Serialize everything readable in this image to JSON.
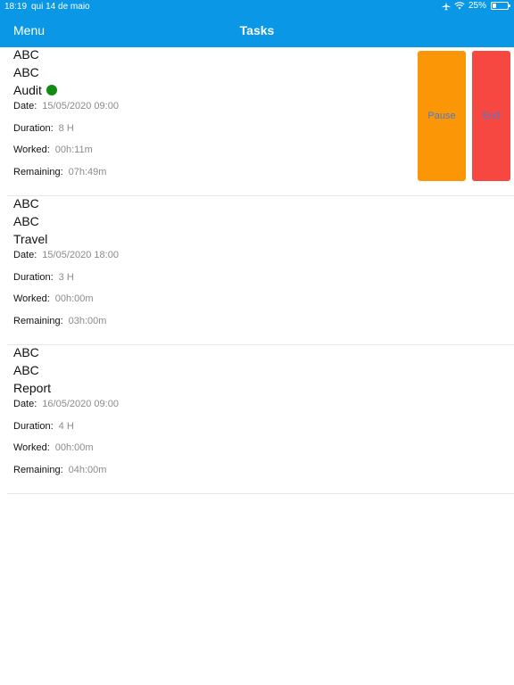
{
  "status_bar": {
    "time": "18:19",
    "date": "qui 14 de maio",
    "battery": "25%"
  },
  "nav": {
    "menu": "Menu",
    "title": "Tasks"
  },
  "labels": {
    "date": "Date:",
    "duration": "Duration:",
    "worked": "Worked:",
    "remaining": "Remaining:"
  },
  "actions": {
    "pause": "Pause",
    "end": "End"
  },
  "tasks": [
    {
      "line1": "ABC",
      "line2": "ABC",
      "kind": "Audit",
      "active": true,
      "date": "15/05/2020 09:00",
      "duration": "8 H",
      "worked": "00h:11m",
      "remaining": "07h:49m"
    },
    {
      "line1": "ABC",
      "line2": "ABC",
      "kind": "Travel",
      "active": false,
      "date": "15/05/2020 18:00",
      "duration": "3 H",
      "worked": "00h:00m",
      "remaining": "03h:00m"
    },
    {
      "line1": "ABC",
      "line2": "ABC",
      "kind": "Report",
      "active": false,
      "date": "16/05/2020 09:00",
      "duration": "4 H",
      "worked": "00h:00m",
      "remaining": "04h:00m"
    }
  ],
  "colors": {
    "nav_bg": "#0a98e6",
    "pause": "#fb9606",
    "end": "#f64740",
    "active_dot": "#138a13"
  }
}
